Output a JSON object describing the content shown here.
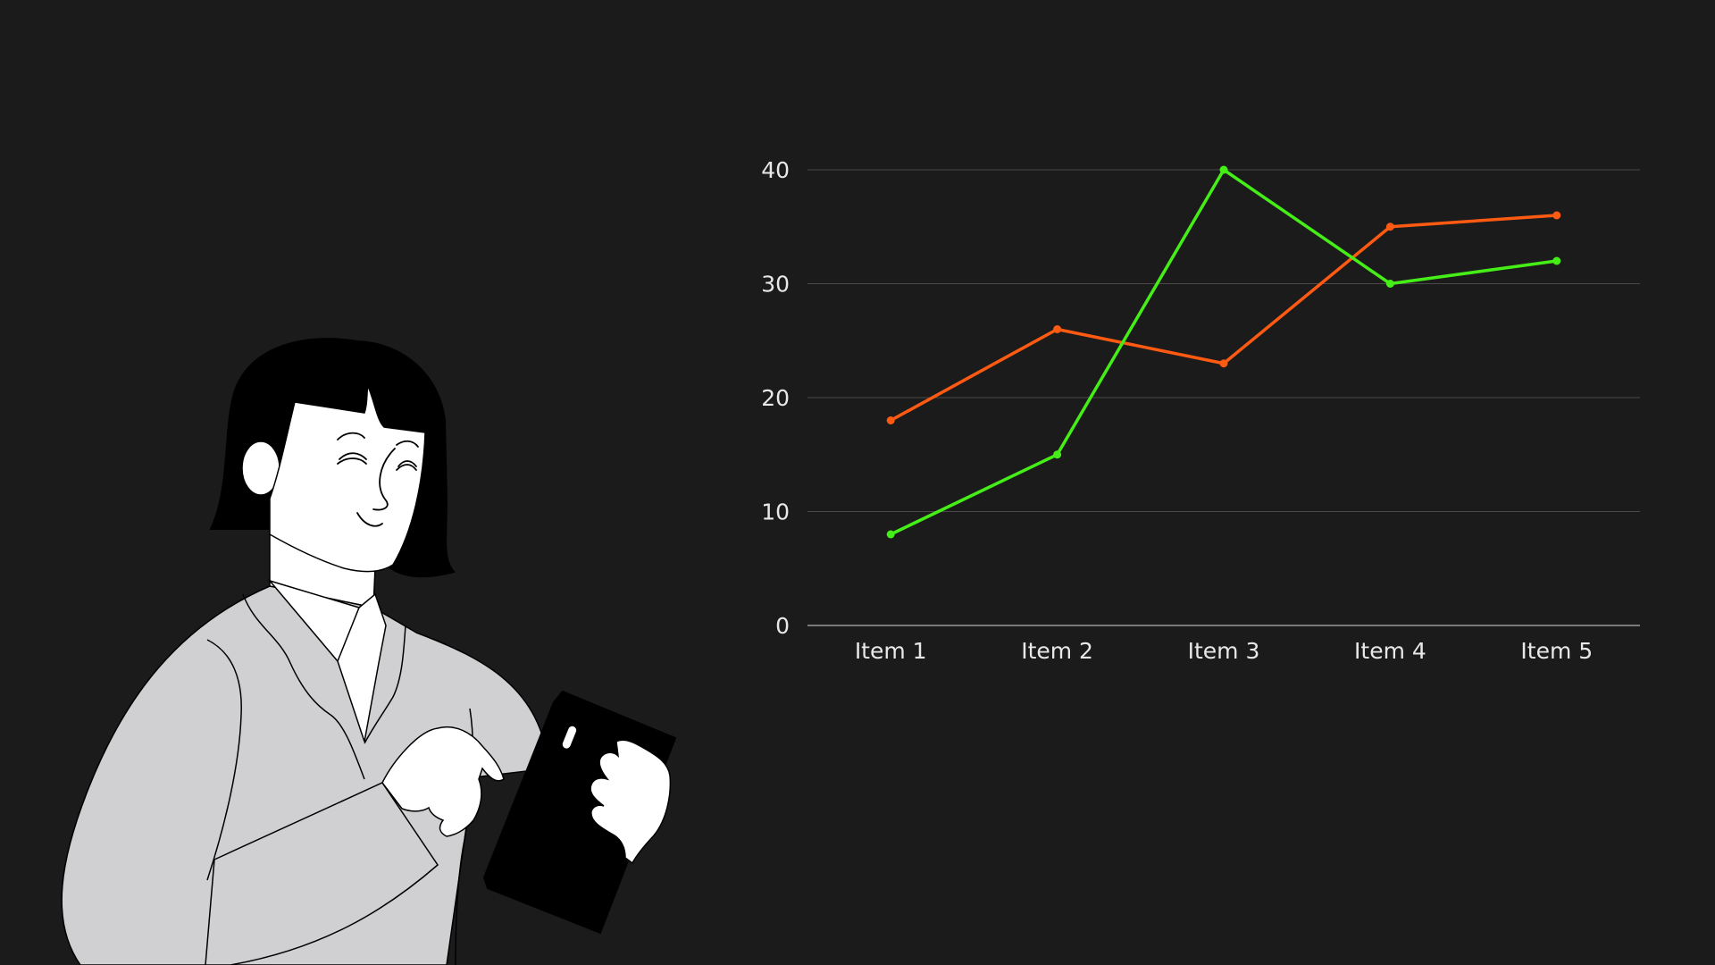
{
  "background_color": "#1b1b1b",
  "illustration": {
    "subject": "person-holding-tablet",
    "colors": {
      "skin": "#ffffff",
      "hair": "#000000",
      "sweater": "#d0cfd1",
      "tablet": "#000000",
      "outline": "#000000"
    }
  },
  "chart_data": {
    "type": "line",
    "title": "",
    "xlabel": "",
    "ylabel": "",
    "categories": [
      "Item 1",
      "Item 2",
      "Item 3",
      "Item 4",
      "Item 5"
    ],
    "ylim": [
      0,
      40
    ],
    "yticks": [
      0,
      10,
      20,
      30,
      40
    ],
    "grid": true,
    "legend": "none",
    "gridline_color": "#4a4a4a",
    "axis_color": "#9a9a9a",
    "label_color": "#e8e8e8",
    "series": [
      {
        "color": "#ff5a12",
        "values": [
          18,
          26,
          23,
          35,
          36
        ]
      },
      {
        "color": "#45ee17",
        "values": [
          8,
          15,
          40,
          30,
          32
        ]
      }
    ]
  }
}
